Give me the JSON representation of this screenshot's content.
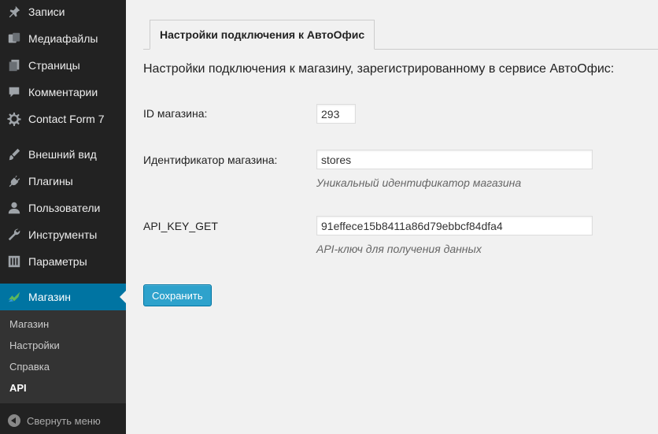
{
  "sidebar": {
    "items": [
      {
        "label": "Записи",
        "icon": "pin-icon"
      },
      {
        "label": "Медиафайлы",
        "icon": "media-icon"
      },
      {
        "label": "Страницы",
        "icon": "pages-icon"
      },
      {
        "label": "Комментарии",
        "icon": "comments-icon"
      },
      {
        "label": "Contact Form 7",
        "icon": "gear-icon"
      },
      {
        "label": "Внешний вид",
        "icon": "brush-icon"
      },
      {
        "label": "Плагины",
        "icon": "plugin-icon"
      },
      {
        "label": "Пользователи",
        "icon": "user-icon"
      },
      {
        "label": "Инструменты",
        "icon": "wrench-icon"
      },
      {
        "label": "Параметры",
        "icon": "settings-icon"
      }
    ],
    "active": {
      "label": "Магазин",
      "icon": "shop-icon"
    },
    "submenu": [
      "Магазин",
      "Настройки",
      "Справка",
      "API"
    ],
    "collapse_label": "Свернуть меню"
  },
  "main": {
    "tab_label": "Настройки подключения к АвтоОфис",
    "intro": "Настройки подключения к магазину, зарегистрированному в сервисе АвтоОфис:",
    "fields": {
      "shop_id": {
        "label": "ID магазина:",
        "value": "293"
      },
      "shop_ident": {
        "label": "Идентификатор магазина:",
        "value": "stores",
        "description": "Уникальный идентификатор магазина"
      },
      "api_key": {
        "label": "API_KEY_GET",
        "value": "91effece15b8411a86d79ebbcf84dfa4",
        "description": "API-ключ для получения данных"
      }
    },
    "save_label": "Сохранить"
  },
  "colors": {
    "sidebar_bg": "#222222",
    "active_bg": "#0074a2",
    "button_bg": "#2ea2cc",
    "page_bg": "#f1f1f1"
  }
}
